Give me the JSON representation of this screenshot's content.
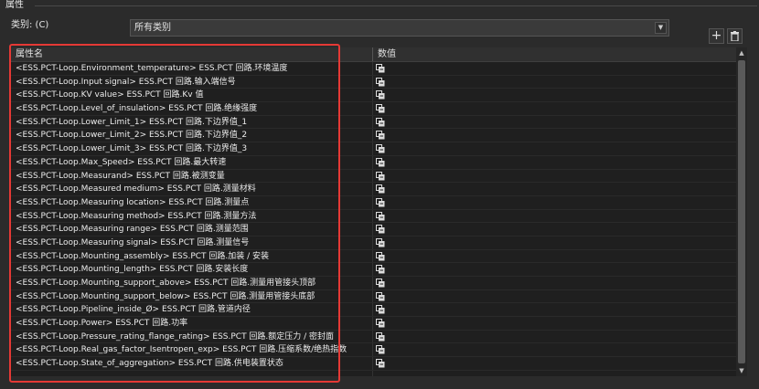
{
  "panel": {
    "title": "属性"
  },
  "category": {
    "label": "类别: (C)",
    "value": "所有类别"
  },
  "grid": {
    "headers": {
      "name": "属性名",
      "value": "数值"
    },
    "rows": [
      "<ESS.PCT-Loop.Environment_temperature> ESS.PCT 回路.环境温度",
      "<ESS.PCT-Loop.Input signal> ESS.PCT 回路.输入端信号",
      "<ESS.PCT-Loop.KV value> ESS.PCT 回路.Kv 值",
      "<ESS.PCT-Loop.Level_of_insulation> ESS.PCT 回路.绝缘强度",
      "<ESS.PCT-Loop.Lower_Limit_1> ESS.PCT 回路.下边界值_1",
      "<ESS.PCT-Loop.Lower_Limit_2> ESS.PCT 回路.下边界值_2",
      "<ESS.PCT-Loop.Lower_Limit_3> ESS.PCT 回路.下边界值_3",
      "<ESS.PCT-Loop.Max_Speed> ESS.PCT 回路.最大转速",
      "<ESS.PCT-Loop.Measurand> ESS.PCT 回路.被测变量",
      "<ESS.PCT-Loop.Measured medium> ESS.PCT 回路.测量材料",
      "<ESS.PCT-Loop.Measuring location> ESS.PCT 回路.测量点",
      "<ESS.PCT-Loop.Measuring method> ESS.PCT 回路.测量方法",
      "<ESS.PCT-Loop.Measuring range> ESS.PCT 回路.测量范围",
      "<ESS.PCT-Loop.Measuring signal> ESS.PCT 回路.测量信号",
      "<ESS.PCT-Loop.Mounting_assembly> ESS.PCT 回路.加装 / 安装",
      "<ESS.PCT-Loop.Mounting_length> ESS.PCT 回路.安装长度",
      "<ESS.PCT-Loop.Mounting_support_above> ESS.PCT 回路.测量用管接头顶部",
      "<ESS.PCT-Loop.Mounting_support_below> ESS.PCT 回路.测量用管接头底部",
      "<ESS.PCT-Loop.Pipeline_inside_Ø> ESS.PCT 回路.管道内径",
      "<ESS.PCT-Loop.Power> ESS.PCT 回路.功率",
      "<ESS.PCT-Loop.Pressure_rating_flange_rating> ESS.PCT 回路.额定压力 / 密封面",
      "<ESS.PCT-Loop.Real_gas_factor_Isentropen_exp> ESS.PCT 回路.压缩系数/绝热指数",
      "<ESS.PCT-Loop.State_of_aggregation> ESS.PCT 回路.供电装置状态"
    ]
  },
  "icons": {
    "value_cell": "edit-value-icon",
    "add": "plus-icon",
    "delete": "trash-icon",
    "dropdown": "chevron-down-icon"
  },
  "colors": {
    "highlight": "#e53935",
    "background": "#2b2b2b",
    "grid": "#1f1f1f"
  }
}
